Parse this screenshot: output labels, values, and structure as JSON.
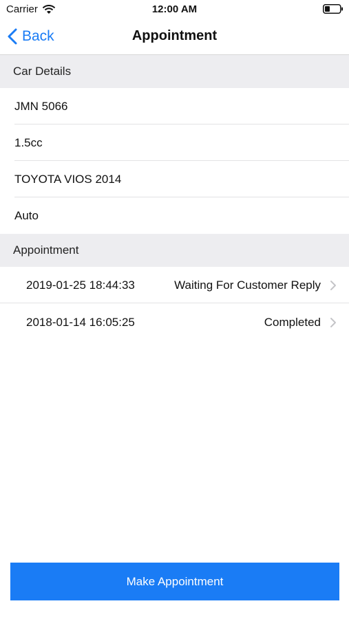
{
  "status_bar": {
    "carrier": "Carrier",
    "time": "12:00 AM"
  },
  "nav": {
    "back_label": "Back",
    "title": "Appointment"
  },
  "car_details": {
    "header": "Car Details",
    "items": [
      "JMN 5066",
      "1.5cc",
      "TOYOTA VIOS 2014",
      "Auto"
    ]
  },
  "appointments": {
    "header": "Appointment",
    "items": [
      {
        "date": "2019-01-25 18:44:33",
        "status": "Waiting For Customer Reply"
      },
      {
        "date": "2018-01-14 16:05:25",
        "status": "Completed"
      }
    ]
  },
  "actions": {
    "make_appointment_label": "Make Appointment"
  },
  "colors": {
    "accent": "#1a7cf5",
    "section_bg": "#ededf0"
  },
  "icons": [
    "wifi-icon",
    "battery-icon",
    "chevron-left-icon",
    "chevron-right-icon"
  ]
}
